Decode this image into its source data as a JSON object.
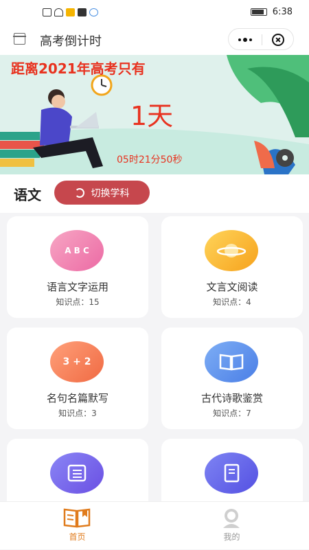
{
  "status": {
    "time": "6:38"
  },
  "header": {
    "title": "高考倒计时"
  },
  "banner": {
    "heading": "距离2021年高考只有",
    "days": "1天",
    "timer": "05时21分50秒"
  },
  "subject": {
    "name": "语文",
    "switch_label": "切换学科"
  },
  "cards": [
    {
      "name": "语言文字运用",
      "count": "知识点：15",
      "icon": "abc-blocks-icon"
    },
    {
      "name": "文言文阅读",
      "count": "知识点：4",
      "icon": "planet-icon"
    },
    {
      "name": "名句名篇默写",
      "count": "知识点：3",
      "icon": "math-board-icon"
    },
    {
      "name": "古代诗歌鉴赏",
      "count": "知识点：7",
      "icon": "open-book-icon"
    },
    {
      "name": "",
      "count": "",
      "icon": "list-icon"
    },
    {
      "name": "",
      "count": "",
      "icon": "notebook-icon"
    }
  ],
  "icon_glyphs": {
    "math": "3 + 2"
  },
  "tabs": [
    {
      "label": "首页",
      "active": true
    },
    {
      "label": "我的",
      "active": false
    }
  ],
  "colors": {
    "accent": "#c6474d",
    "active_tab": "#e07b1c",
    "banner_text": "#e8321f"
  }
}
